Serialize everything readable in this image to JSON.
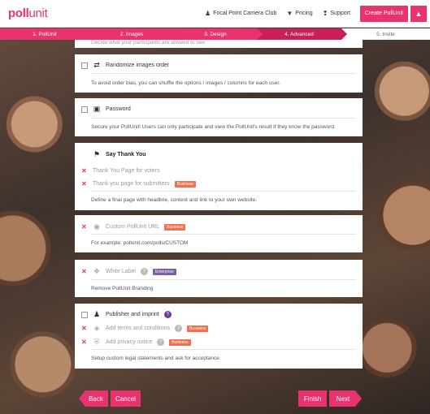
{
  "header": {
    "logo_bold": "poll",
    "logo_light": "unit",
    "org_name": "Focal Point Camera Club",
    "pricing": "Pricing",
    "support": "Support",
    "create_button": "Create PollUnit"
  },
  "steps": [
    {
      "label": "1. PollUnit"
    },
    {
      "label": "2. Images"
    },
    {
      "label": "3. Design"
    },
    {
      "label": "4. Advanced"
    },
    {
      "label": "5. Invite"
    }
  ],
  "options": {
    "partial_top_text": "Decide what your participants are allowed to see.",
    "randomize": {
      "title": "Randomize images order",
      "desc": "To avoid order bias, you can shuffle the options / images / columns for each user."
    },
    "password": {
      "title": "Password",
      "desc": "Secure your PollUnit! Users can only participate and view the PollUnit's result if they know the password."
    },
    "thank_you": {
      "title": "Say Thank You",
      "voters": "Thank You Page for voters",
      "submitters": "Thank you page for submitters",
      "business_badge": "Business",
      "desc": "Define a final page with headline, content and link to your own website."
    },
    "custom_url": {
      "title": "Custom PollUnit URL",
      "badge": "Business",
      "desc": "For example: pollunit.com/polls/CUSTOM"
    },
    "white_label": {
      "title": "White Label",
      "badge": "Enterprise",
      "desc": "Remove PollUnit Branding"
    },
    "publisher": {
      "title": "Publisher and imprint",
      "terms": "Add terms and conditions",
      "terms_badge": "Business",
      "privacy": "Add privacy notice",
      "privacy_badge": "Business",
      "desc": "Setup custom legal statements and ask for acceptance"
    }
  },
  "footer": {
    "back": "Back",
    "cancel": "Cancel",
    "finish": "Finish",
    "next": "Next"
  }
}
